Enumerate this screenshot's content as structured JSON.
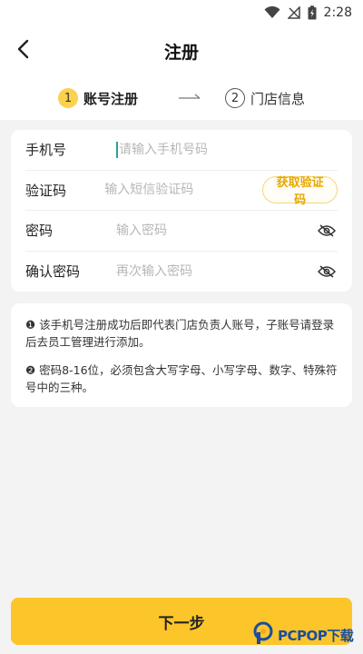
{
  "status_bar": {
    "time": "2:28",
    "icons": [
      "wifi-icon",
      "no-signal-icon",
      "battery-charging-icon"
    ]
  },
  "header": {
    "title": "注册",
    "back_icon": "chevron-left-icon"
  },
  "steps": [
    {
      "number": "1",
      "label": "账号注册",
      "state": "active"
    },
    {
      "number": "2",
      "label": "门店信息",
      "state": "inactive"
    }
  ],
  "form": {
    "phone": {
      "label": "手机号",
      "placeholder": "请输入手机号码",
      "value": ""
    },
    "code": {
      "label": "验证码",
      "placeholder": "输入短信验证码",
      "value": "",
      "button_label": "获取验证码"
    },
    "password": {
      "label": "密码",
      "placeholder": "输入密码",
      "value": "",
      "toggle_icon": "eye-off-icon"
    },
    "confirm_password": {
      "label": "确认密码",
      "placeholder": "再次输入密码",
      "value": "",
      "toggle_icon": "eye-off-icon"
    }
  },
  "notes": [
    "❶ 该手机号注册成功后即代表门店负责人账号，子账号请登录后去员工管理进行添加。",
    "❷ 密码8-16位，必须包含大写字母、小写字母、数字、特殊符号中的三种。"
  ],
  "next_button": {
    "label": "下一步"
  },
  "watermark": {
    "text": "PCPOP下载"
  },
  "colors": {
    "accent": "#fcc52a",
    "step_active": "#fbd24e",
    "code_button_text": "#e6a700",
    "caret": "#2aa29c"
  }
}
